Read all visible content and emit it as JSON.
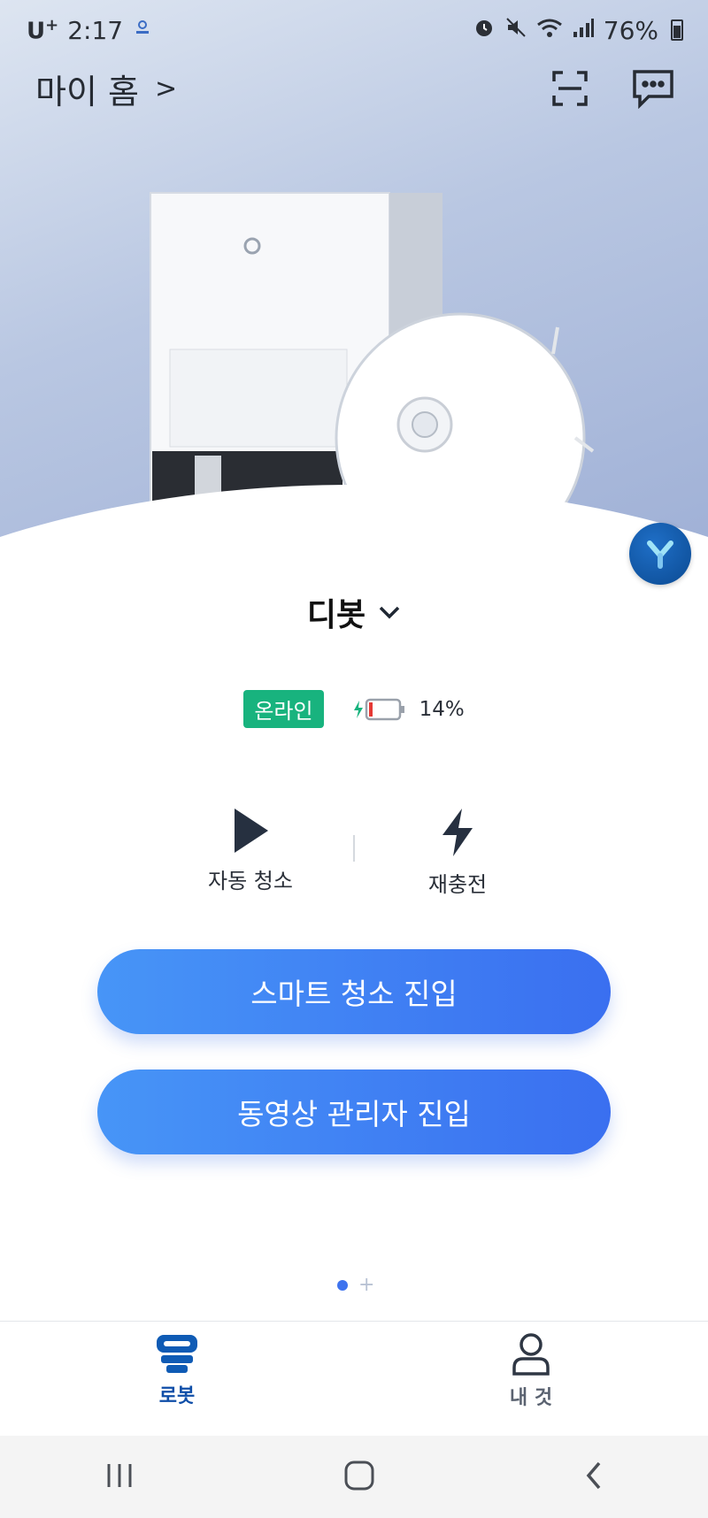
{
  "status_bar": {
    "carrier": "U",
    "carrier_sup": "+",
    "time": "2:17",
    "battery": "76%"
  },
  "header": {
    "home_label": "마이 홈",
    "home_chevron": ">"
  },
  "device": {
    "name": "디봇",
    "status_label": "온라인",
    "battery_percent": "14%",
    "battery_level": 0.14
  },
  "actions": [
    {
      "label": "자동 청소",
      "icon": "play-icon"
    },
    {
      "label": "재충전",
      "icon": "bolt-icon"
    }
  ],
  "buttons": {
    "smart_clean": "스마트 청소 진입",
    "video_manager": "동영상 관리자 진입"
  },
  "pager": {
    "pages": 2,
    "current": 1
  },
  "bottom_nav": [
    {
      "label": "로봇",
      "icon": "robot-icon",
      "active": true
    },
    {
      "label": "내 것",
      "icon": "person-icon",
      "active": false
    }
  ],
  "colors": {
    "accent": "#3a6ff0",
    "online": "#18b37e",
    "nav_active": "#0f4ea8",
    "battery_low": "#e53935"
  }
}
